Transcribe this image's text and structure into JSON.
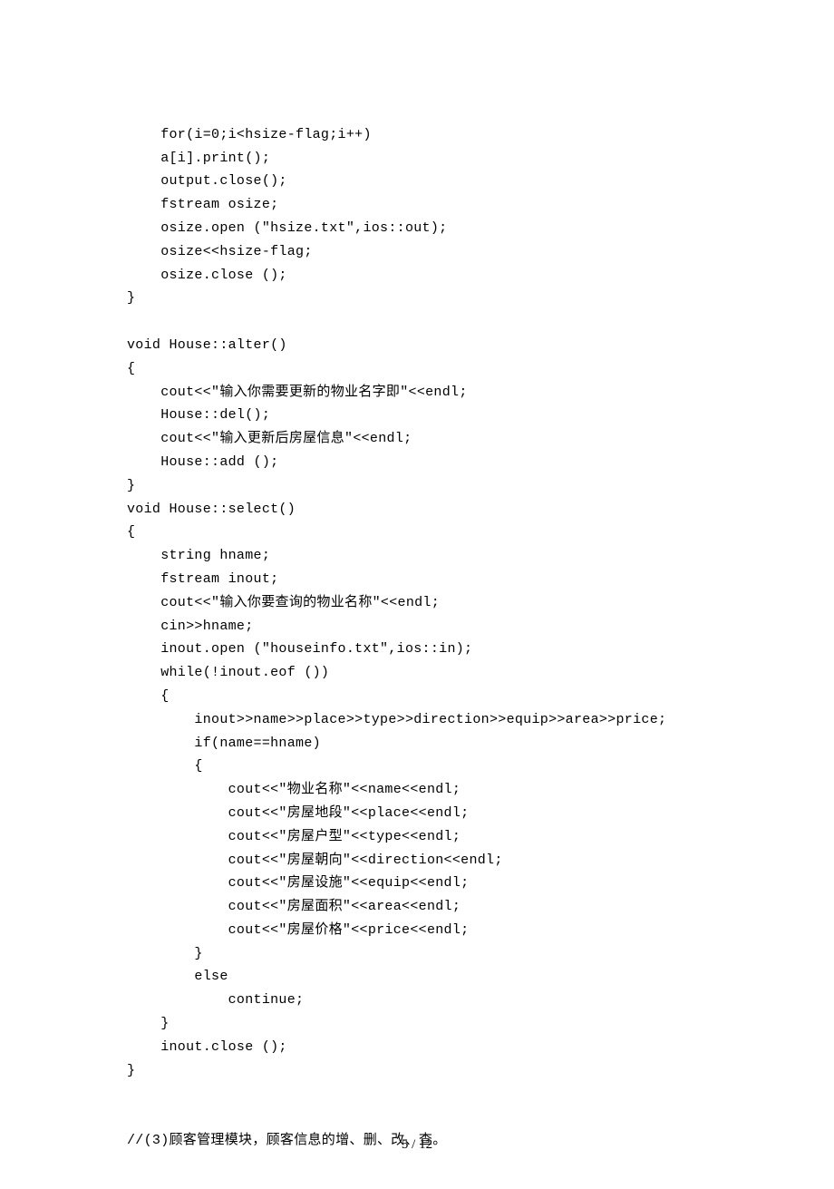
{
  "code": {
    "l1": "    for(i=0;i<hsize-flag;i++)",
    "l2": "    a[i].print();",
    "l3": "    output.close();",
    "l4": "    fstream osize;",
    "l5": "    osize.open (\"hsize.txt\",ios::out);",
    "l6": "    osize<<hsize-flag;",
    "l7": "    osize.close ();",
    "l8": "}",
    "l9": "",
    "l10": "void House::alter()",
    "l11": "{",
    "l12": "    cout<<\"输入你需要更新的物业名字即\"<<endl;",
    "l13": "    House::del();",
    "l14": "    cout<<\"输入更新后房屋信息\"<<endl;",
    "l15": "    House::add ();",
    "l16": "}",
    "l17": "void House::select()",
    "l18": "{",
    "l19": "    string hname;",
    "l20": "    fstream inout;",
    "l21": "    cout<<\"输入你要查询的物业名称\"<<endl;",
    "l22": "    cin>>hname;",
    "l23": "    inout.open (\"houseinfo.txt\",ios::in);",
    "l24": "    while(!inout.eof ())",
    "l25": "    {",
    "l26": "        inout>>name>>place>>type>>direction>>equip>>area>>price;",
    "l27": "        if(name==hname)",
    "l28": "        {",
    "l29": "            cout<<\"物业名称\"<<name<<endl;",
    "l30": "            cout<<\"房屋地段\"<<place<<endl;",
    "l31": "            cout<<\"房屋户型\"<<type<<endl;",
    "l32": "            cout<<\"房屋朝向\"<<direction<<endl;",
    "l33": "            cout<<\"房屋设施\"<<equip<<endl;",
    "l34": "            cout<<\"房屋面积\"<<area<<endl;",
    "l35": "            cout<<\"房屋价格\"<<price<<endl;",
    "l36": "        }",
    "l37": "        else",
    "l38": "            continue;",
    "l39": "    }",
    "l40": "    inout.close ();",
    "l41": "}",
    "l42": "",
    "l43": "",
    "l44": "//(3)顾客管理模块，顾客信息的增、删、改、查。"
  },
  "footer": "5 / 12"
}
